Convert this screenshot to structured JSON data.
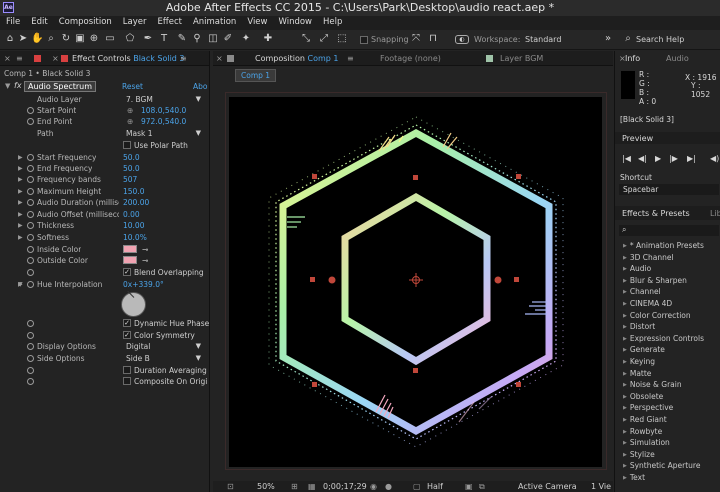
{
  "app": {
    "title": "Adobe After Effects CC 2015 - C:\\Users\\Park\\Desktop\\audio react.aep *",
    "logo": "Ae"
  },
  "menu": [
    "File",
    "Edit",
    "Composition",
    "Layer",
    "Effect",
    "Animation",
    "View",
    "Window",
    "Help"
  ],
  "toolbar": {
    "snapping_label": "Snapping",
    "workspace_label": "Workspace:",
    "workspace_value": "Standard",
    "search_label": "Search Help"
  },
  "effect_controls": {
    "tab_label": "Effect Controls",
    "tab_layer": "Black Solid 3",
    "breadcrumb": "Comp 1 • Black Solid 3",
    "effect_name": "Audio Spectrum",
    "reset": "Reset",
    "about": "Abo",
    "params": [
      {
        "label": "Audio Layer",
        "value": "7. BGM",
        "kind": "dropdown"
      },
      {
        "label": "Start Point",
        "value": "108.0,540.0",
        "kind": "point"
      },
      {
        "label": "End Point",
        "value": "972.0,540.0",
        "kind": "point"
      },
      {
        "label": "Path",
        "value": "Mask 1",
        "kind": "dropdown"
      },
      {
        "label": "",
        "value": "Use Polar Path",
        "kind": "checkbox"
      },
      {
        "label": "Start Frequency",
        "value": "50.0",
        "kind": "num"
      },
      {
        "label": "End Frequency",
        "value": "50.0",
        "kind": "num"
      },
      {
        "label": "Frequency bands",
        "value": "507",
        "kind": "num"
      },
      {
        "label": "Maximum Height",
        "value": "150.0",
        "kind": "num"
      },
      {
        "label": "Audio Duration (millise",
        "value": "200.00",
        "kind": "num"
      },
      {
        "label": "Audio Offset (milliseco",
        "value": "0.00",
        "kind": "num"
      },
      {
        "label": "Thickness",
        "value": "10.00",
        "kind": "num"
      },
      {
        "label": "Softness",
        "value": "10.0%",
        "kind": "num"
      },
      {
        "label": "Inside Color",
        "value": "",
        "kind": "color"
      },
      {
        "label": "Outside Color",
        "value": "",
        "kind": "color"
      },
      {
        "label": "",
        "value": "Blend Overlapping",
        "kind": "checkbox-on"
      },
      {
        "label": "Hue Interpolation",
        "value": "0x+339.0°",
        "kind": "num"
      },
      {
        "label": "",
        "value": "Dynamic Hue Phase",
        "kind": "checkbox-on"
      },
      {
        "label": "",
        "value": "Color Symmetry",
        "kind": "checkbox-on"
      },
      {
        "label": "Display Options",
        "value": "Digital",
        "kind": "dropdown"
      },
      {
        "label": "Side Options",
        "value": "Side B",
        "kind": "dropdown"
      },
      {
        "label": "",
        "value": "Duration Averaging",
        "kind": "checkbox"
      },
      {
        "label": "",
        "value": "Composite On Origi",
        "kind": "checkbox"
      }
    ]
  },
  "composition": {
    "tab_label": "Composition",
    "tab_comp": "Comp 1",
    "footage_tab": "Footage (none)",
    "layer_tab": "Layer BGM",
    "comp_button": "Comp 1",
    "zoom": "50%",
    "timecode": "0;00;17;29",
    "resolution": "Half",
    "camera": "Active Camera",
    "views": "1 Vie"
  },
  "info": {
    "tab_info": "Info",
    "tab_audio": "Audio",
    "r": "R :",
    "g": "G :",
    "b": "B :",
    "a": "A : 0",
    "x": "X : 1916",
    "y": "Y : 1052",
    "layer": "[Black Solid 3]"
  },
  "preview": {
    "title": "Preview",
    "shortcut_label": "Shortcut",
    "shortcut_value": "Spacebar"
  },
  "effects_presets": {
    "title": "Effects & Presets",
    "lib_tab": "Lib",
    "items": [
      "* Animation Presets",
      "3D Channel",
      "Audio",
      "Blur & Sharpen",
      "Channel",
      "CINEMA 4D",
      "Color Correction",
      "Distort",
      "Expression Controls",
      "Generate",
      "Keying",
      "Matte",
      "Noise & Grain",
      "Obsolete",
      "Perspective",
      "Red Giant",
      "Rowbyte",
      "Simulation",
      "Stylize",
      "Synthetic Aperture",
      "Text"
    ]
  },
  "colors": {
    "accent_blue": "#4ba3e8",
    "inside_color": "#f0a3b1",
    "outside_color": "#f0a3b1"
  }
}
